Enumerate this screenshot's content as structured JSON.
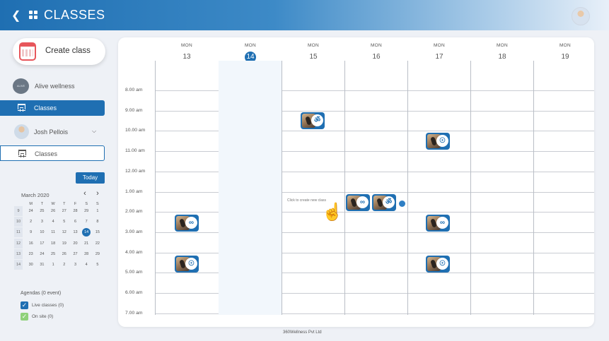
{
  "header": {
    "title": "CLASSES"
  },
  "sidebar": {
    "create_label": "Create class",
    "org_logo_text": "ALIVE",
    "org_name": "Alive wellness",
    "nav_classes_label": "Classes",
    "user_name": "Josh Pellois",
    "user_classes_label": "Classes",
    "today_label": "Today"
  },
  "minical": {
    "title": "March 2020",
    "weekdays": [
      "M",
      "T",
      "W",
      "T",
      "F",
      "S",
      "S"
    ],
    "weeks": [
      {
        "wk": "9",
        "days": [
          "24",
          "25",
          "26",
          "27",
          "28",
          "29",
          "1"
        ]
      },
      {
        "wk": "10",
        "days": [
          "2",
          "3",
          "4",
          "5",
          "6",
          "7",
          "8"
        ]
      },
      {
        "wk": "11",
        "days": [
          "9",
          "10",
          "11",
          "12",
          "13",
          "14",
          "15"
        ]
      },
      {
        "wk": "12",
        "days": [
          "16",
          "17",
          "18",
          "19",
          "20",
          "21",
          "22"
        ]
      },
      {
        "wk": "13",
        "days": [
          "23",
          "24",
          "25",
          "26",
          "27",
          "28",
          "29"
        ]
      },
      {
        "wk": "14",
        "days": [
          "30",
          "31",
          "1",
          "2",
          "3",
          "4",
          "5"
        ]
      }
    ],
    "week_labels": [
      "9",
      "10",
      "11",
      "12",
      "13",
      "14"
    ],
    "selected": "14"
  },
  "agendas": {
    "title": "Agendas (0 event)",
    "items": [
      {
        "label": "Live classes (0)",
        "color": "#1f6fb2"
      },
      {
        "label": "On site (0)",
        "color": "#8fd17a"
      }
    ]
  },
  "calendar": {
    "days": [
      {
        "weekday": "MON",
        "num": "13"
      },
      {
        "weekday": "MON",
        "num": "14"
      },
      {
        "weekday": "MON",
        "num": "15"
      },
      {
        "weekday": "MON",
        "num": "16"
      },
      {
        "weekday": "MON",
        "num": "17"
      },
      {
        "weekday": "MON",
        "num": "18"
      },
      {
        "weekday": "MON",
        "num": "19"
      }
    ],
    "times": [
      "8.00 am",
      "9.00 am",
      "10.00 am",
      "11.00 am",
      "12.00 am",
      "1.00 am",
      "2.00 am",
      "3.00 am",
      "4.00 am",
      "5.00 am",
      "6.00 am",
      "7.00 am"
    ],
    "hint": "Click to create new class"
  },
  "footer": {
    "text": "360Wellness Pvt Ltd"
  },
  "colors": {
    "accent": "#1f6fb2"
  }
}
